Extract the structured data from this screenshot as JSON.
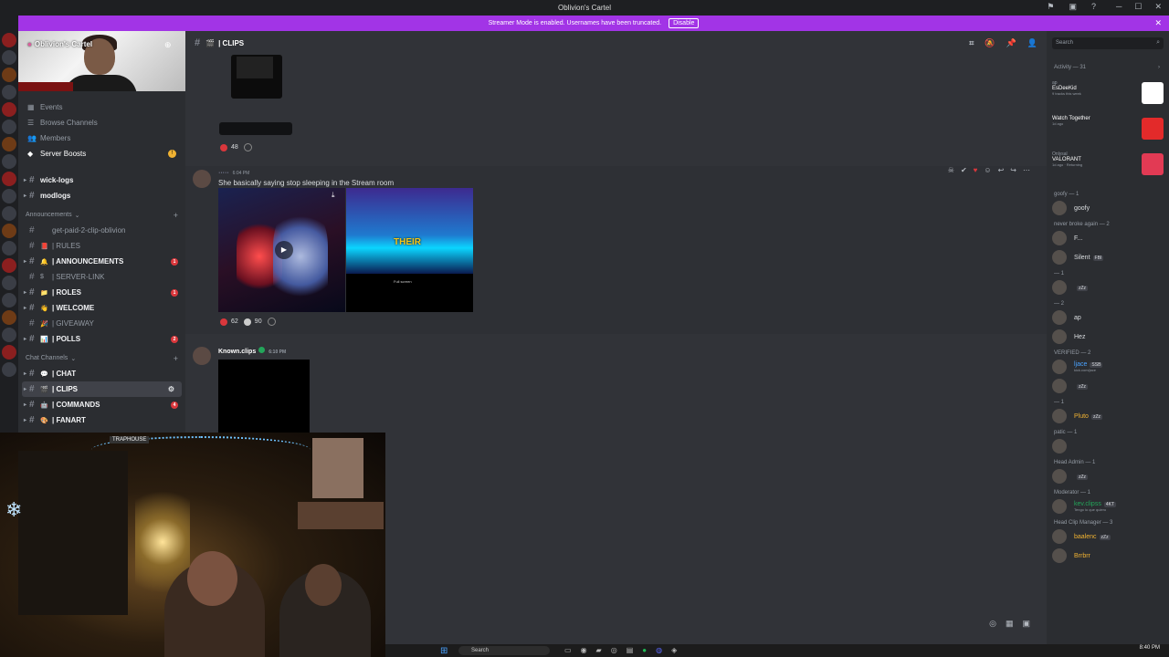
{
  "window": {
    "title": "Oblivion's Cartel"
  },
  "streamer_bar": {
    "message": "Streamer Mode is enabled. Usernames have been truncated.",
    "disable_label": "Disable",
    "close": "✕"
  },
  "server": {
    "name": "Oblivion's Cartel",
    "nav": [
      {
        "label": "Events",
        "icon": "calendar-icon"
      },
      {
        "label": "Browse Channels",
        "icon": "browse-icon"
      },
      {
        "label": "Members",
        "icon": "members-icon"
      },
      {
        "label": "Server Boosts",
        "icon": "boost-icon",
        "badge": "!"
      }
    ],
    "channels_top": [
      {
        "label": "wick-logs",
        "bold": true
      },
      {
        "label": "modlogs",
        "bold": true
      }
    ],
    "announcements_category": "Announcements",
    "announcement_channels": [
      {
        "label": "get-paid-2-clip-oblivion",
        "emoji": "",
        "bold": false,
        "mention": ""
      },
      {
        "label": "| RULES",
        "emoji": "📕",
        "bold": false,
        "mention": ""
      },
      {
        "label": "| ANNOUNCEMENTS",
        "emoji": "🔔",
        "bold": true,
        "mention": "1"
      },
      {
        "label": "| SERVER-LINK",
        "emoji": "$",
        "bold": false,
        "mention": ""
      },
      {
        "label": "| ROLES",
        "emoji": "📁",
        "bold": true,
        "mention": "1"
      },
      {
        "label": "| WELCOME",
        "emoji": "👋",
        "bold": true,
        "mention": ""
      },
      {
        "label": "| GIVEAWAY",
        "emoji": "🎉",
        "bold": false,
        "mention": ""
      },
      {
        "label": "| POLLS",
        "emoji": "📊",
        "bold": true,
        "mention": "2"
      }
    ],
    "chat_category": "Chat Channels",
    "chat_channels": [
      {
        "label": "| CHAT",
        "emoji": "💬",
        "bold": true,
        "mention": ""
      },
      {
        "label": "| CLIPS",
        "emoji": "🎬",
        "bold": true,
        "active": true,
        "mention": ""
      },
      {
        "label": "| COMMANDS",
        "emoji": "🤖",
        "bold": true,
        "mention": "4"
      },
      {
        "label": "| FANART",
        "emoji": "🎨",
        "bold": true,
        "mention": ""
      }
    ]
  },
  "channel_header": {
    "name": "| CLIPS",
    "search_placeholder": "Search"
  },
  "messages": [
    {
      "reactions": [
        {
          "count": "48",
          "color": "#da373c"
        }
      ]
    },
    {
      "time": "6:04 PM",
      "text": "She basically saying stop sleeping in the Stream room",
      "media_overlay_text": "THEIR",
      "media_fullscreen": "Full screen",
      "reactions": [
        {
          "count": "62",
          "color": "#da373c"
        },
        {
          "count": "90",
          "color": "#cccccc"
        }
      ]
    },
    {
      "author": "Known.clips",
      "time": "6:10 PM"
    }
  ],
  "members_panel": {
    "search_placeholder": "Search",
    "activity_header": "Activity — 31",
    "activities": [
      {
        "user": "ap",
        "title": "EsDeeKid",
        "sub": "9 tracks this week",
        "color": "#ffffff"
      },
      {
        "user": "",
        "title": "Watch Together",
        "sub": "1d ago",
        "color": "#e32a2a"
      },
      {
        "user": "Onlysal",
        "title": "VALORANT",
        "sub": "1d ago · Returning",
        "color": "#e23a54"
      }
    ],
    "groups": [
      {
        "header": "goofy — 1",
        "members": [
          {
            "name": "goofy",
            "tag": "",
            "color": "#dbdee1"
          }
        ]
      },
      {
        "header": "never broke again — 2",
        "members": [
          {
            "name": "F...",
            "tag": "",
            "color": "#dbdee1"
          },
          {
            "name": "Silent",
            "tag": "FBI",
            "color": "#dbdee1"
          }
        ]
      },
      {
        "header": "— 1",
        "members": [
          {
            "name": "",
            "tag": "zZz",
            "color": "#dbdee1"
          }
        ]
      },
      {
        "header": "— 2",
        "members": [
          {
            "name": "ap",
            "tag": "",
            "color": "#dbdee1"
          },
          {
            "name": "Hez",
            "tag": "",
            "color": "#dbdee1"
          }
        ]
      },
      {
        "header": "VERIFIED — 2",
        "members": [
          {
            "name": "ljace",
            "tag": "SSB",
            "color": "#4aa3ff",
            "sub": "kick.com/jace"
          },
          {
            "name": "",
            "tag": "zZz",
            "color": "#dbdee1"
          }
        ]
      },
      {
        "header": "— 1",
        "members": [
          {
            "name": "Pluto",
            "tag": "zZz",
            "color": "#f0b232"
          }
        ]
      },
      {
        "header": "patic — 1",
        "members": [
          {
            "name": "",
            "tag": "",
            "color": "#dbdee1"
          }
        ]
      },
      {
        "header": "Head Admin — 1",
        "members": [
          {
            "name": "",
            "tag": "zZz",
            "color": "#dbdee1"
          }
        ]
      },
      {
        "header": "Moderator — 1",
        "members": [
          {
            "name": "kev.clipss",
            "tag": "4KT",
            "color": "#23a55a",
            "sub": "Tengo lo que quiero"
          }
        ]
      },
      {
        "header": "Head Clip Manager — 3",
        "members": [
          {
            "name": "baalenc",
            "tag": "zZz",
            "color": "#f0b232"
          },
          {
            "name": "Brrbrr",
            "tag": "",
            "color": "#f0b232"
          }
        ]
      }
    ]
  },
  "webcam_room": {
    "sign": "TRAPHOUSE"
  },
  "taskbar": {
    "search": "Search",
    "time": "8:40 PM"
  },
  "colors": {
    "accent": "#a234e6",
    "background": "#313338",
    "sidebar": "#2b2d31"
  }
}
